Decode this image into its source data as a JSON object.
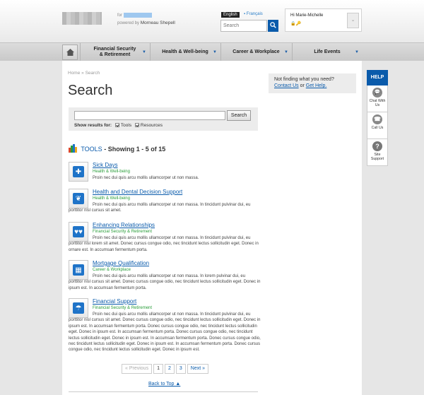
{
  "header": {
    "for_label": "for",
    "powered_by_prefix": "powered by",
    "powered_by_brand": "Morneau Shepell",
    "lang_active": "English",
    "lang_other": "Français",
    "search_placeholder": "Search",
    "user_greeting": "Hi Marie-Michelle"
  },
  "nav": {
    "items": [
      {
        "label": "Financial Security & Retirement"
      },
      {
        "label": "Health & Well-being"
      },
      {
        "label": "Career & Workplace"
      },
      {
        "label": "Life Events"
      }
    ]
  },
  "breadcrumb": {
    "home": "Home",
    "sep": "»",
    "current": "Search"
  },
  "page_title": "Search",
  "search_panel": {
    "button": "Search",
    "show_results_for": "Show results for:",
    "option_tools": "Tools",
    "option_resources": "Resources"
  },
  "tools_header": {
    "label": "TOOLS",
    "summary": "- Showing 1 - 5 of 15"
  },
  "results": [
    {
      "title": "Sick Days",
      "category": "Health & Well-being",
      "desc": "Proin nec dui quis arcu mollis ullamcorper ut non massa."
    },
    {
      "title": "Health and Dental Decision Support",
      "category": "Health & Well-being",
      "desc": "Proin nec dui quis arcu mollis ullamcorper ut non massa. In tincidunt pulvinar dui, eu porttitor nisl cursus sit amet."
    },
    {
      "title": "Enhancing Relationships",
      "category": "Financial Security & Retirement",
      "desc": "Proin nec dui quis arcu mollis ullamcorper ut non massa. In tincidunt pulvinar dui, eu porttitor nisl lorem sit amet. Donec cursus congue odio, nec tincidunt lectus sollicitudin eget. Donec in ornare est. In accumsan fermentum porta."
    },
    {
      "title": "Mortgage Qualification",
      "category": "Career & Workplace",
      "desc": "Proin nec dui quis arcu mollis ullamcorper ut non massa. In lorem pulvinar dui, eu porttitor nisl cursus sit amet. Donec cursus congue odio, nec tincidunt lectus sollicitudin eget. Donec in ipsum est. In accumsan fermentum porta."
    },
    {
      "title": "Financial Support",
      "category": "Financial Security & Retirement",
      "desc": "Proin nec dui quis arcu mollis ullamcorper ut non massa. In tincidunt pulvinar dui, eu porttitor nisl cursus sit amet. Donec cursus congue odio, nec tincidunt lectus sollicitudin eget. Donec in ipsum est. In accumsan fermentum porta. Donec cursus congue odio, nec tincidunt lectus sollicitudin eget. Donec in ipsum est. In accumsan fermentum porta. Donec cursus congue odio, nec tincidunt lectus sollicitudin eget. Donec in ipsum est. In accumsan fermentum porta. Donec cursus congue odio, nec tincidunt lectus sollicitudin eget. Donec in ipsum est. In accumsan fermentum porta. Donec cursus congue odio, nec tincidunt lectus sollicitudin eget. Donec in ipsum est."
    }
  ],
  "pager": {
    "prev": "« Previous",
    "p1": "1",
    "p2": "2",
    "p3": "3",
    "next": "Next »"
  },
  "back_to_top": "Back to Top ▲",
  "not_finding": {
    "line1": "Not finding what you need?",
    "contact": "Contact Us",
    "or": "or",
    "help": "Get Help."
  },
  "help_rail": {
    "tab": "HELP",
    "chat": "Chat With Us",
    "call": "Call Us",
    "site_support": "Site Support"
  },
  "colors": {
    "brand_blue": "#0a5bab",
    "category_green": "#2a9d3a"
  }
}
